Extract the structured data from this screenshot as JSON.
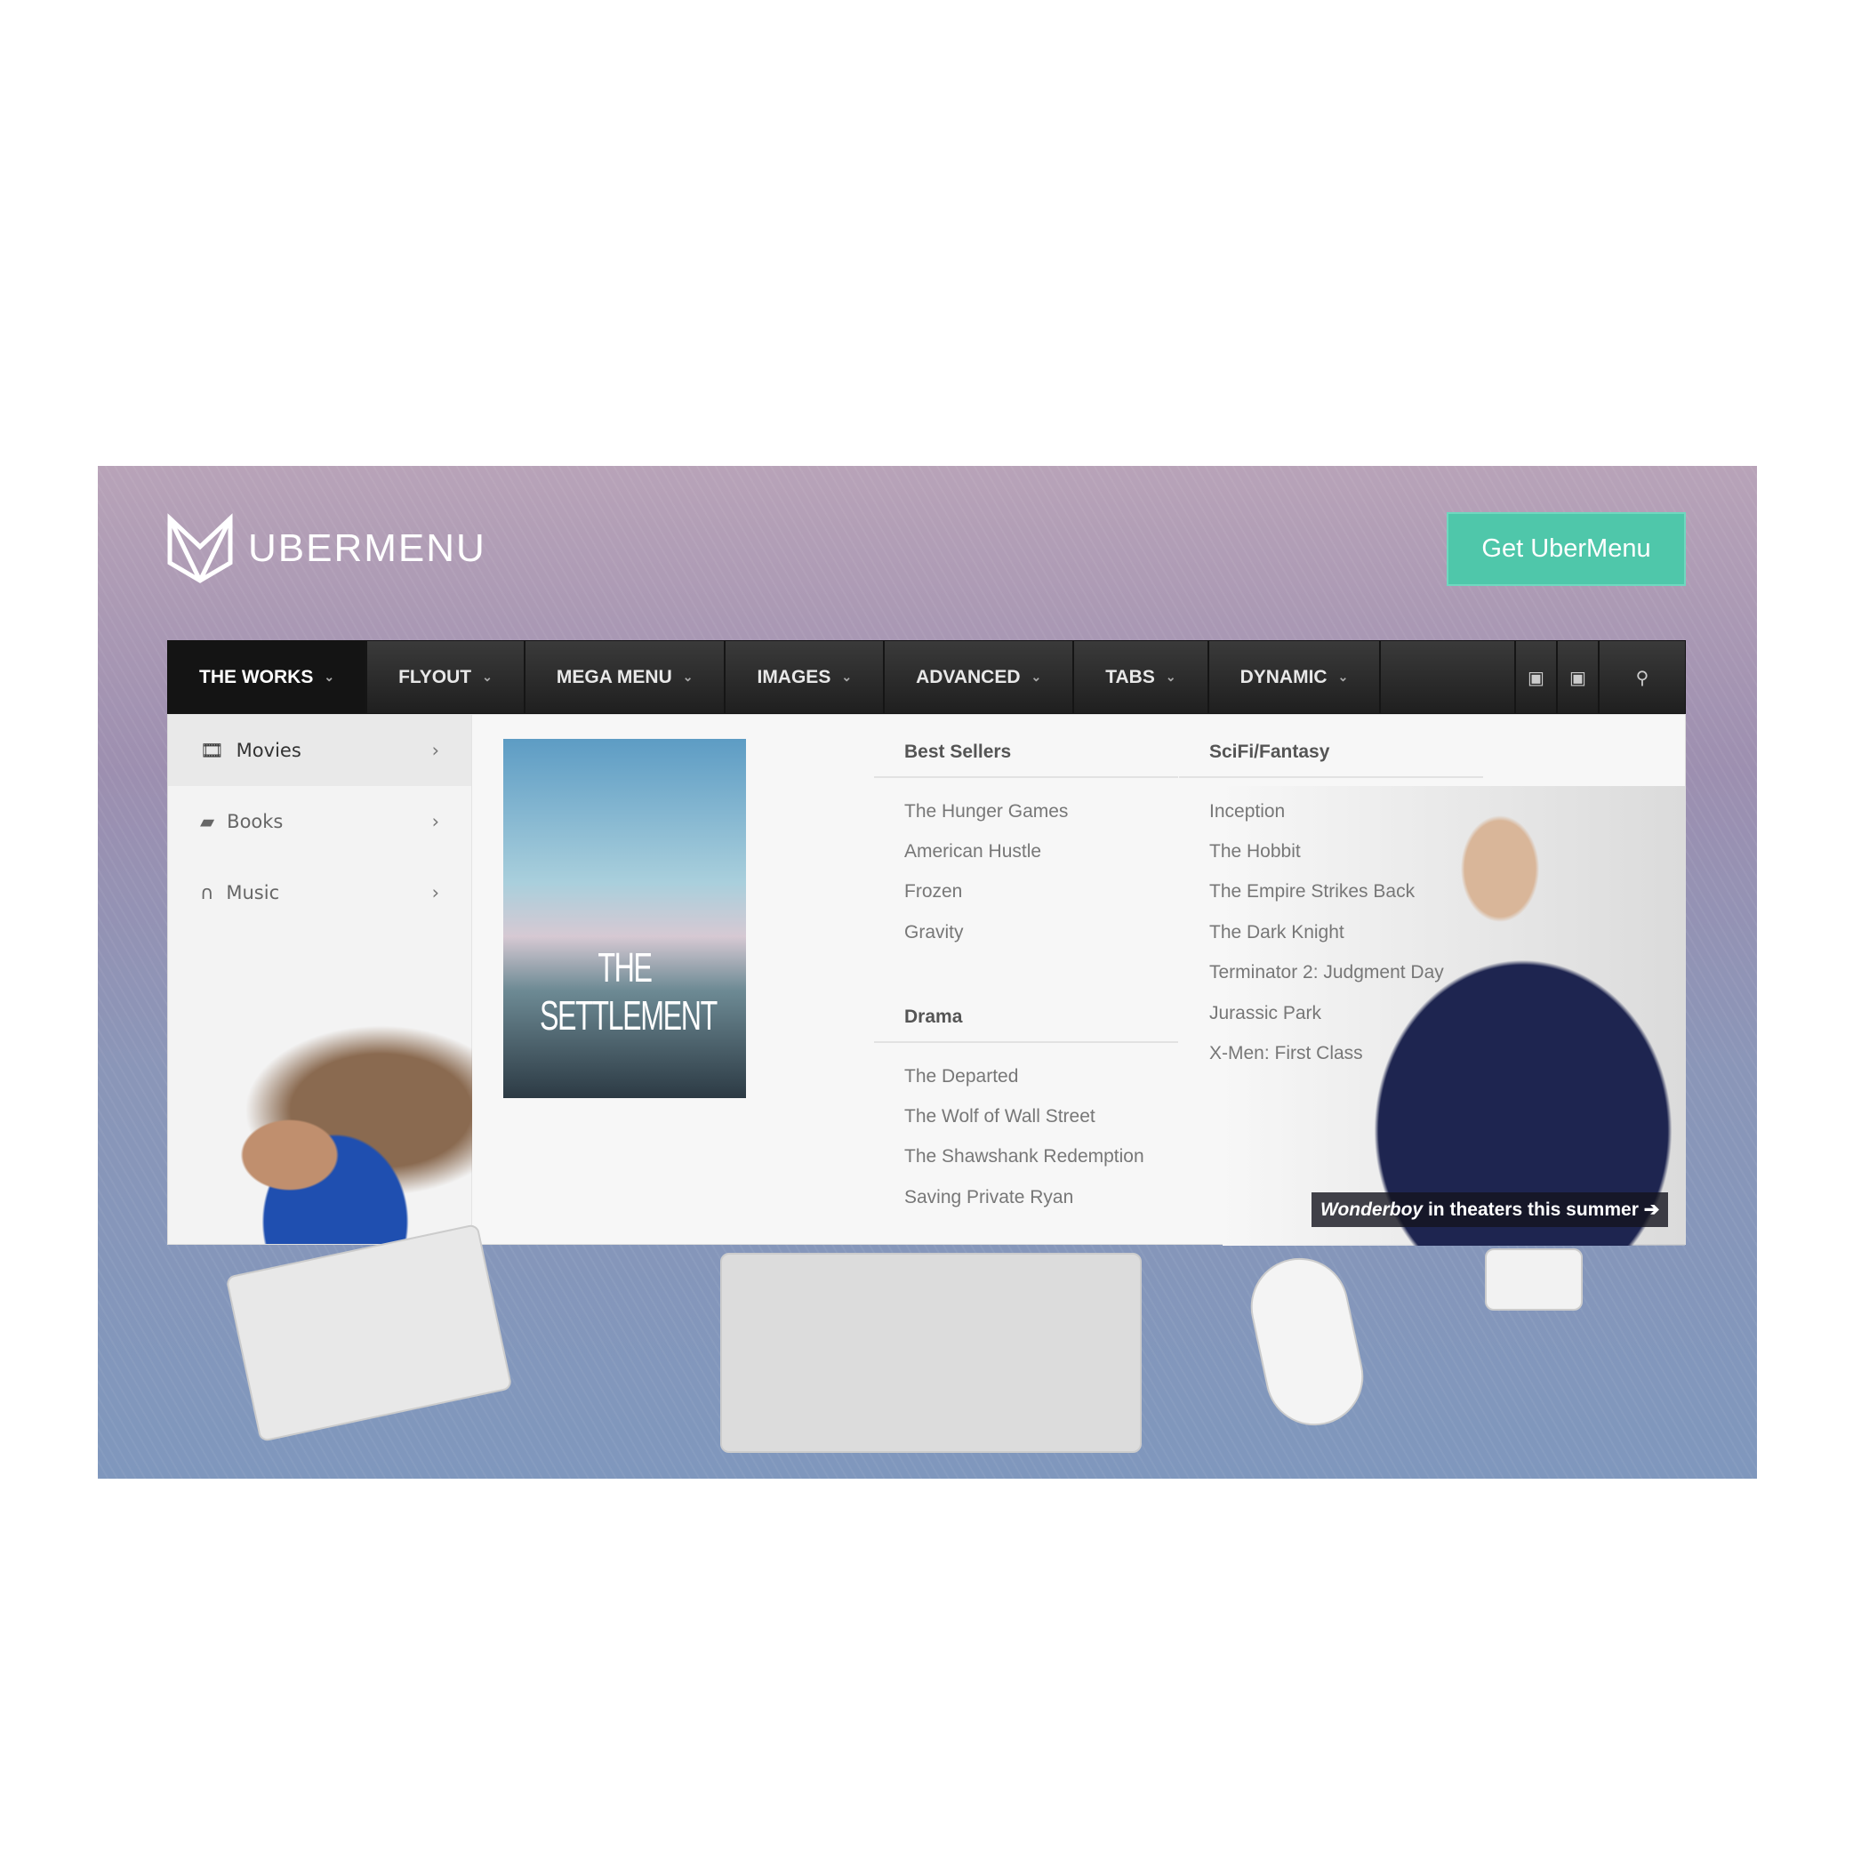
{
  "brand": {
    "name": "UBERMENU",
    "cta": "Get UberMenu",
    "accent": "#4fc7aa"
  },
  "nav": {
    "items": [
      {
        "label": "THE WORKS",
        "active": true
      },
      {
        "label": "FLYOUT"
      },
      {
        "label": "MEGA MENU"
      },
      {
        "label": "IMAGES"
      },
      {
        "label": "ADVANCED"
      },
      {
        "label": "TABS"
      },
      {
        "label": "DYNAMIC"
      }
    ],
    "icons": [
      "twitter-icon",
      "facebook-icon",
      "search-icon"
    ]
  },
  "sidebar": {
    "items": [
      {
        "label": "Movies",
        "icon": "film-icon",
        "active": true
      },
      {
        "label": "Books",
        "icon": "book-icon"
      },
      {
        "label": "Music",
        "icon": "headphones-icon"
      }
    ]
  },
  "poster": {
    "title": "THE SETTLEMENT"
  },
  "columns": {
    "best_sellers": {
      "heading": "Best Sellers",
      "items": [
        "The Hunger Games",
        "American Hustle",
        "Frozen",
        "Gravity"
      ]
    },
    "drama": {
      "heading": "Drama",
      "items": [
        "The Departed",
        "The Wolf of Wall Street",
        "The Shawshank Redemption",
        "Saving Private Ryan"
      ]
    },
    "scifi": {
      "heading": "SciFi/Fantasy",
      "items": [
        "Inception",
        "The Hobbit",
        "The Empire Strikes Back",
        "The Dark Knight",
        "Terminator 2: Judgment Day",
        "Jurassic Park",
        "X-Men: First Class"
      ]
    }
  },
  "caption": {
    "title": "Wonderboy",
    "text": " in theaters this summer"
  }
}
